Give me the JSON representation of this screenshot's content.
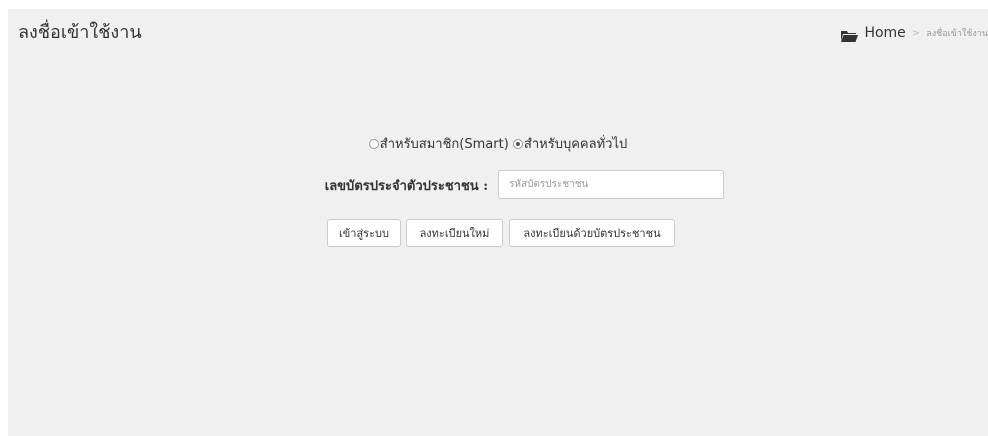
{
  "page": {
    "title": "ลงชื่อเข้าใช้งาน"
  },
  "breadcrumb": {
    "icon": "folder-open-icon",
    "home_label": "Home",
    "separator": ">",
    "current_label": "ลงชื่อเข้าใช้งาน"
  },
  "login_type": {
    "options": [
      {
        "label": "สำหรับสมาชิก(Smart)",
        "selected": false
      },
      {
        "label": "สำหรับบุคคลทั่วไป",
        "selected": true
      }
    ]
  },
  "form": {
    "id_label": "เลขบัตรประจำตัวประชาชน :",
    "id_placeholder": "รหัสบัตรประชาชน",
    "id_value": ""
  },
  "buttons": {
    "login": "เข้าสู่ระบบ",
    "register": "ลงทะเบียนใหม่",
    "register_card": "ลงทะเบียนด้วยบัตรประชาชน"
  },
  "colors": {
    "panel_background": "#f0f0f0",
    "text": "#333333",
    "muted": "#999999"
  }
}
